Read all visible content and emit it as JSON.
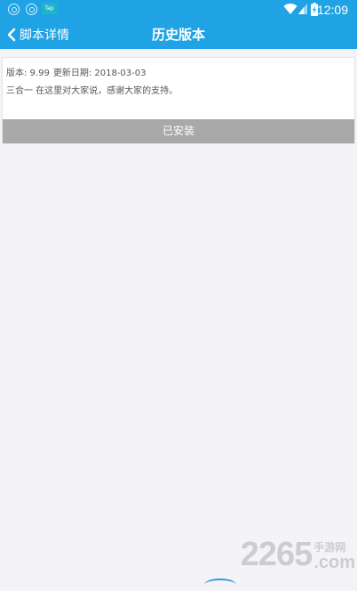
{
  "status_bar": {
    "time": "12:09",
    "app_icon_label": "Tap",
    "icons": [
      "notification-app-icon",
      "notification-app-icon",
      "taptap-icon",
      "wifi-icon",
      "signal-icon",
      "battery-charging-icon"
    ]
  },
  "header": {
    "back_label": "脚本详情",
    "title": "历史版本",
    "background_color": "#20a3e4"
  },
  "version": {
    "version_text": "版本: 9.99",
    "update_date_text": "更新日期: 2018-03-03",
    "description": "三合一 在这里对大家说，感谢大家的支持。",
    "install_button_label": "已安装",
    "install_button_color": "#a9a9a9"
  },
  "watermark": {
    "number": "2265",
    "site_cn": "手游网",
    "domain": ".com"
  }
}
